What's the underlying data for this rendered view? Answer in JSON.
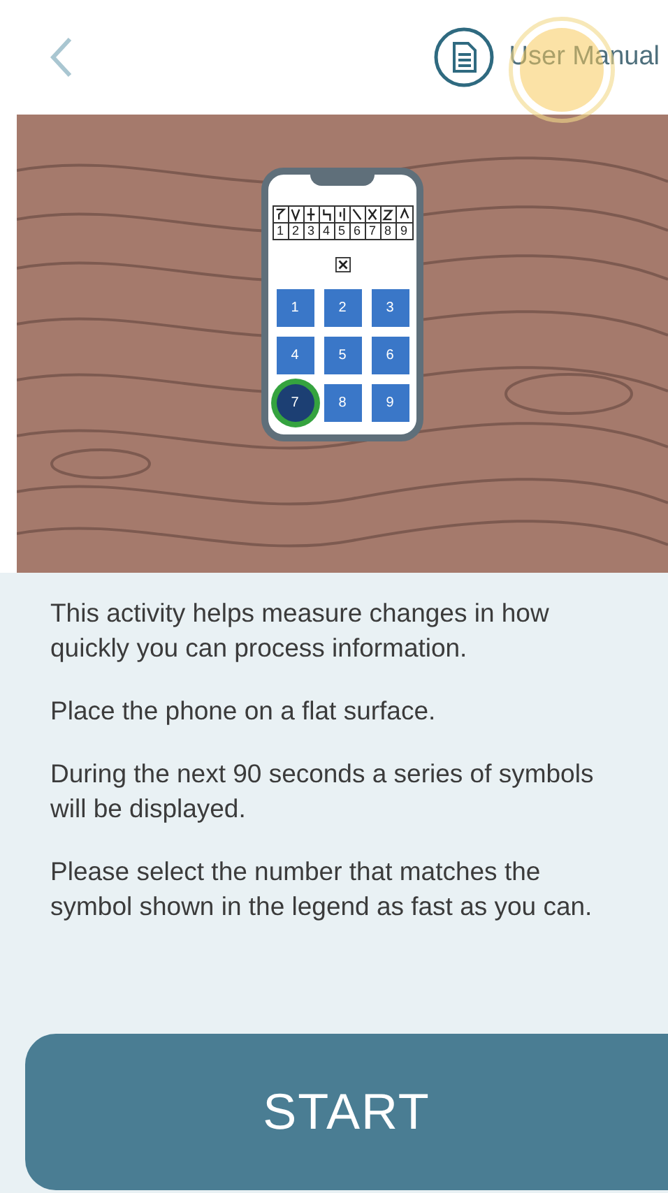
{
  "header": {
    "user_manual": "User Manual"
  },
  "illustration": {
    "legend": [
      "1",
      "2",
      "3",
      "4",
      "5",
      "6",
      "7",
      "8",
      "9"
    ],
    "keypad": [
      {
        "label": "1",
        "selected": false
      },
      {
        "label": "2",
        "selected": false
      },
      {
        "label": "3",
        "selected": false
      },
      {
        "label": "4",
        "selected": false
      },
      {
        "label": "5",
        "selected": false
      },
      {
        "label": "6",
        "selected": false
      },
      {
        "label": "7",
        "selected": true
      },
      {
        "label": "8",
        "selected": false
      },
      {
        "label": "9",
        "selected": false
      }
    ]
  },
  "paragraphs": [
    "This activity helps measure changes in how quickly you can process information.",
    "Place the phone on a flat surface.",
    "During the next 90 seconds a series of symbols will be displayed.",
    "Please select the number that matches the symbol shown in the legend as fast as you can."
  ],
  "start_button": "START"
}
